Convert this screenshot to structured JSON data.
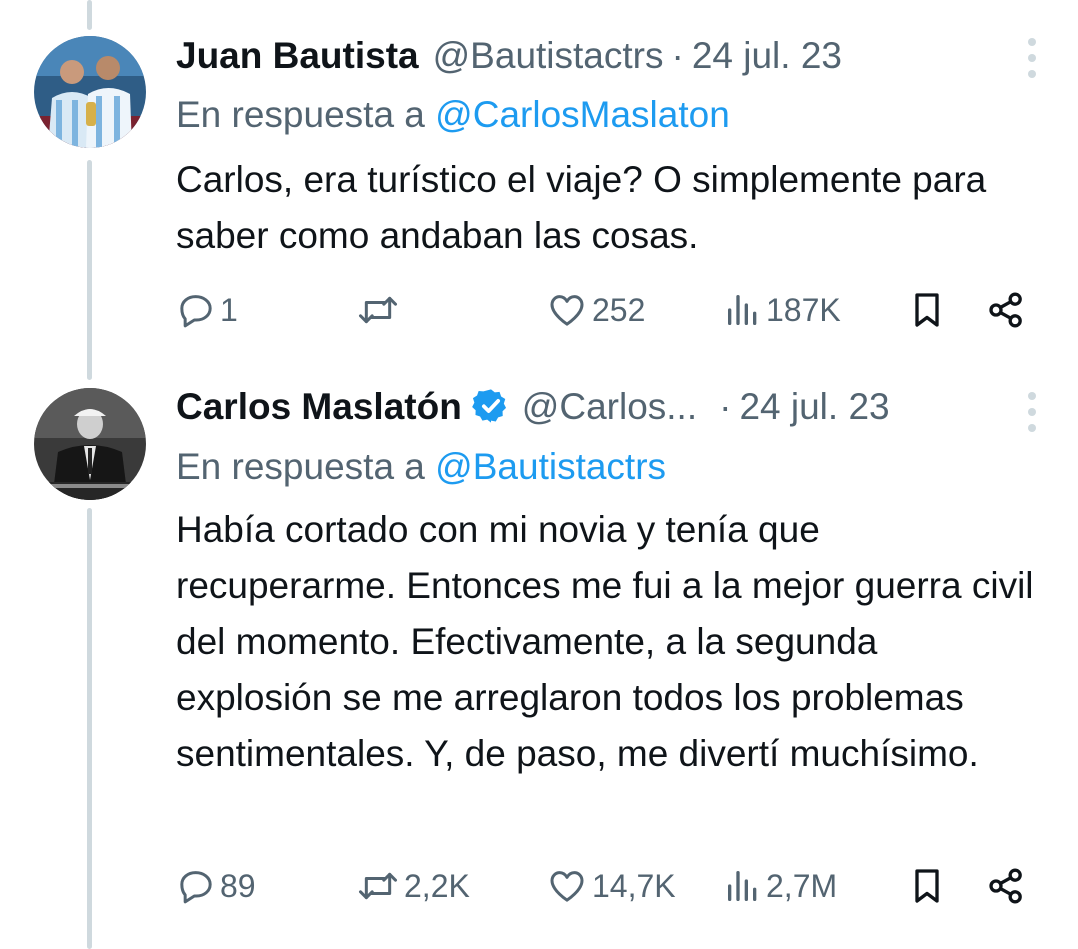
{
  "tweets": [
    {
      "author": {
        "name": "Juan Bautista",
        "handle": "@Bautistactrs",
        "verified": false
      },
      "separator": "·",
      "date": "24 jul. 23",
      "reply_prefix": "En respuesta a",
      "reply_to": "@CarlosMaslaton",
      "text": "Carlos, era turístico el viaje? O simplemente para saber como andaban las cosas.",
      "stats": {
        "replies": "1",
        "retweets": "",
        "likes": "252",
        "views": "187K"
      }
    },
    {
      "author": {
        "name": "Carlos Maslatón",
        "handle": "@Carlos...",
        "verified": true
      },
      "separator": "·",
      "date": "24 jul. 23",
      "reply_prefix": "En respuesta a",
      "reply_to": "@Bautistactrs",
      "text": "Había cortado con mi novia y tenía que recuperarme. Entonces me fui a la mejor guerra civil del momento. Efectivamente, a la segunda explosión se me arreglaron todos los problemas sentimentales. Y, de paso, me divertí muchísimo.",
      "stats": {
        "replies": "89",
        "retweets": "2,2K",
        "likes": "14,7K",
        "views": "2,7M"
      }
    }
  ],
  "colors": {
    "text": "#0f1419",
    "secondary": "#536471",
    "link": "#1d9bf0",
    "thread_line": "#cfd9de",
    "verified_badge": "#1d9bf0"
  },
  "icons": [
    "reply-icon",
    "retweet-icon",
    "like-icon",
    "views-icon",
    "bookmark-icon",
    "share-icon",
    "more-icon",
    "verified-icon"
  ]
}
